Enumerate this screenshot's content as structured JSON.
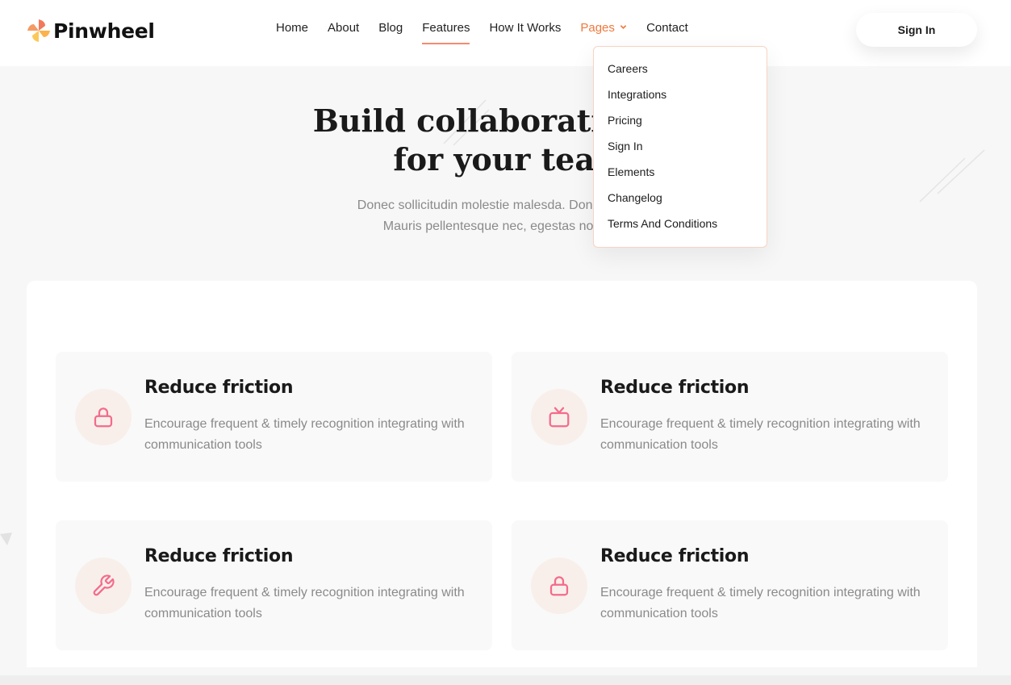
{
  "brand": {
    "name": "Pinwheel"
  },
  "nav": {
    "items": [
      {
        "label": "Home",
        "state": "normal"
      },
      {
        "label": "About",
        "state": "normal"
      },
      {
        "label": "Blog",
        "state": "normal"
      },
      {
        "label": "Features",
        "state": "active"
      },
      {
        "label": "How It Works",
        "state": "normal"
      },
      {
        "label": "Pages",
        "state": "open"
      },
      {
        "label": "Contact",
        "state": "normal"
      }
    ],
    "signin_label": "Sign In"
  },
  "dropdown": {
    "items": [
      "Careers",
      "Integrations",
      "Pricing",
      "Sign In",
      "Elements",
      "Changelog",
      "Terms And Conditions"
    ]
  },
  "hero": {
    "title_line1": "Build collaborative wo",
    "title_line2": "for your tean",
    "sub_line1": "Donec sollicitudin molestie malesda. Donec sollitudi",
    "sub_line2": "Mauris pellentesque nec, egestas non nisi."
  },
  "features": [
    {
      "icon": "lock-icon",
      "title": "Reduce friction",
      "text": "Encourage frequent & timely recognition integrating with communication tools"
    },
    {
      "icon": "tv-icon",
      "title": "Reduce friction",
      "text": "Encourage frequent & timely recognition integrating with communication tools"
    },
    {
      "icon": "wrench-icon",
      "title": "Reduce friction",
      "text": "Encourage frequent & timely recognition integrating with communication tools"
    },
    {
      "icon": "lock-icon",
      "title": "Reduce friction",
      "text": "Encourage frequent & timely recognition integrating with communication tools"
    }
  ],
  "colors": {
    "accent": "#f0783c",
    "icon_pink": "#f46b8a",
    "icon_bg": "#f8efeb",
    "dropdown_border": "#f9d3c2"
  }
}
